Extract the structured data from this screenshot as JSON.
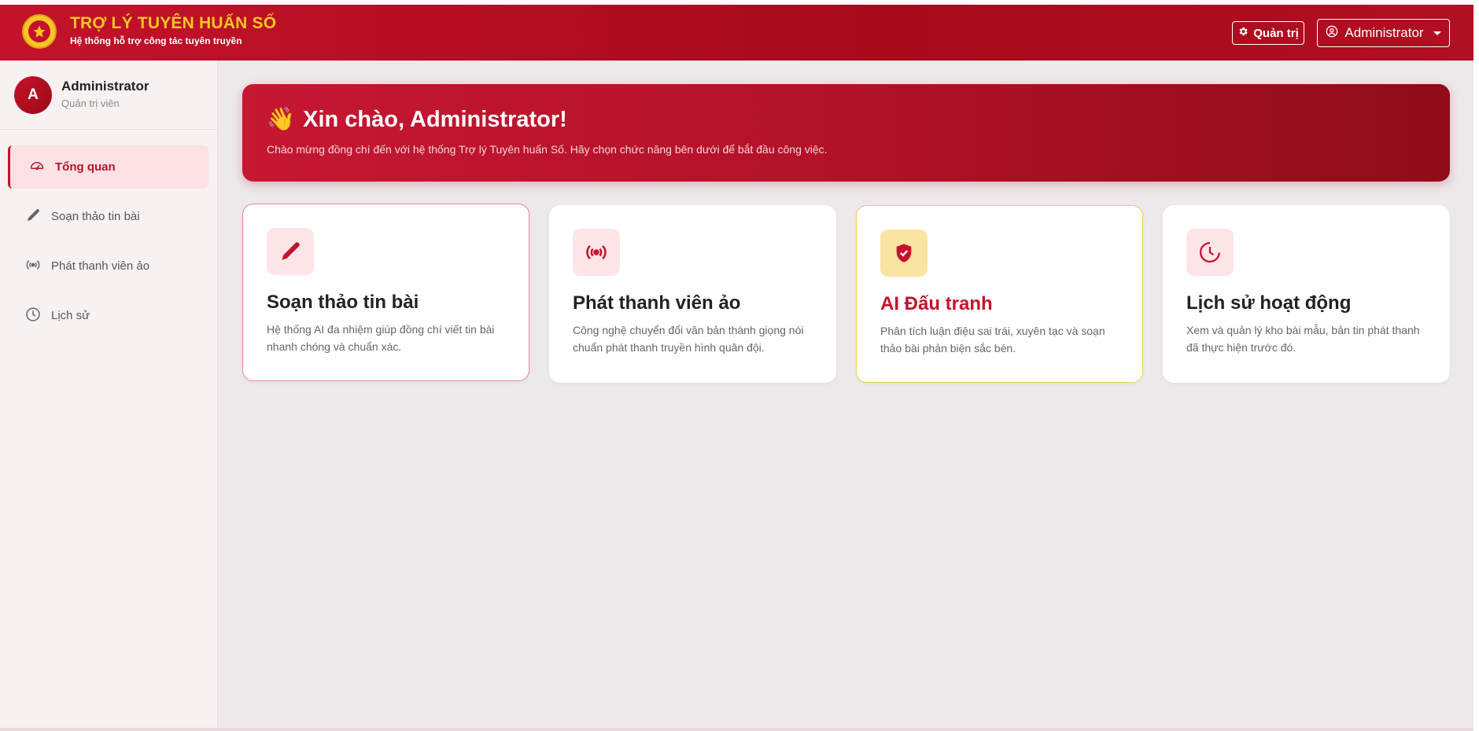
{
  "colors": {
    "primary": "#c4122b",
    "accent_gold": "#f6c623",
    "active_bg": "#fde1e4"
  },
  "header": {
    "title": "TRỢ LÝ TUYÊN HUẤN SỐ",
    "subtitle": "Hệ thống hỗ trợ công tác tuyên truyền",
    "admin_button": "Quản trị",
    "user_button": "Administrator"
  },
  "sidebar": {
    "profile": {
      "initial": "A",
      "name": "Administrator",
      "role": "Quản trị viên"
    },
    "items": [
      {
        "label": "Tổng quan",
        "icon": "gauge-icon",
        "active": true
      },
      {
        "label": "Soạn thảo tin bài",
        "icon": "pen-icon",
        "active": false
      },
      {
        "label": "Phát thanh viên ảo",
        "icon": "broadcast-icon",
        "active": false
      },
      {
        "label": "Lịch sử",
        "icon": "clock-icon",
        "active": false
      }
    ]
  },
  "welcome": {
    "emoji": "👋",
    "title": "Xin chào, Administrator!",
    "message": "Chào mừng đồng chí đến với hệ thống Trợ lý Tuyên huấn Số. Hãy chọn chức năng bên dưới để bắt đầu công việc."
  },
  "cards": [
    {
      "title": "Soạn thảo tin bài",
      "description": "Hệ thống AI đa nhiệm giúp đồng chí viết tin bài nhanh chóng và chuẩn xác.",
      "icon": "pen-icon"
    },
    {
      "title": "Phát thanh viên ảo",
      "description": "Công nghệ chuyển đổi văn bản thành giọng nói chuẩn phát thanh truyền hình quân đội.",
      "icon": "broadcast-icon"
    },
    {
      "title": "AI Đấu tranh",
      "description": "Phân tích luận điệu sai trái, xuyên tạc và soạn thảo bài phản biện sắc bén.",
      "icon": "shield-check-icon"
    },
    {
      "title": "Lịch sử hoạt động",
      "description": "Xem và quản lý kho bài mẫu, bản tin phát thanh đã thực hiện trước đó.",
      "icon": "history-icon"
    }
  ]
}
